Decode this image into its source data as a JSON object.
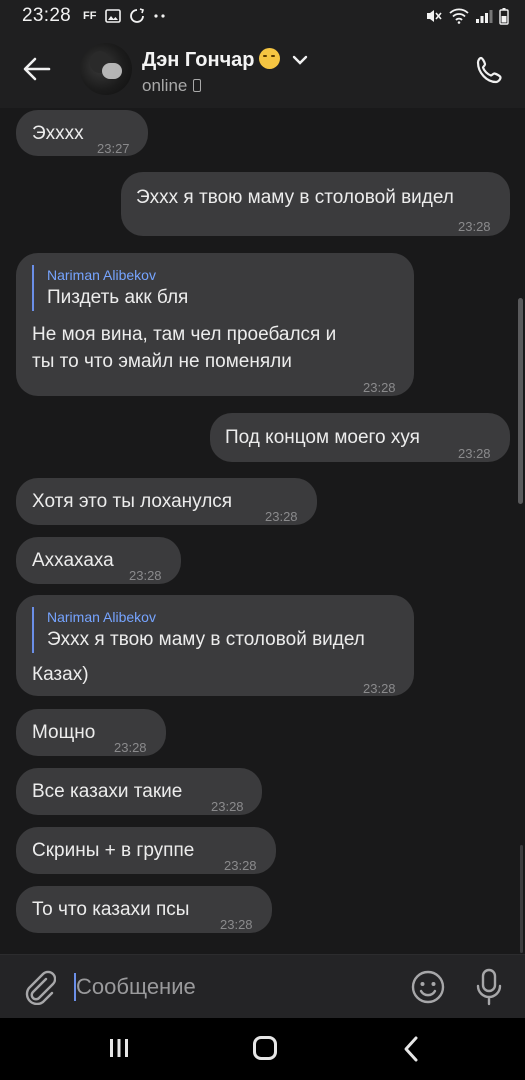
{
  "status_bar": {
    "time": "23:28",
    "ff_label": "FF",
    "icons_left": [
      "ff-icon",
      "image-icon",
      "sync-icon",
      "more-dots-icon"
    ],
    "icons_right": [
      "mute-icon",
      "wifi-icon",
      "signal-icon",
      "battery-icon"
    ]
  },
  "header": {
    "contact_name": "Дэн Гончар",
    "contact_status": "online",
    "name_emoji": "smiling-face-emoji"
  },
  "messages": [
    {
      "direction": "in",
      "text": "Эхххх",
      "time": "23:27"
    },
    {
      "direction": "out",
      "text": "Эхxx я твою маму в столовой видел",
      "time": "23:28"
    },
    {
      "direction": "in",
      "reply": {
        "author": "Nariman Alibekov",
        "text": "Пиздеть акк бля"
      },
      "text_lines": [
        "Не моя вина, там чел проебался и",
        "ты то что эмайл не поменяли"
      ],
      "time": "23:28"
    },
    {
      "direction": "out",
      "text": "Под концом моего хуя",
      "time": "23:28"
    },
    {
      "direction": "in",
      "text": "Хотя это ты лоханулся",
      "time": "23:28"
    },
    {
      "direction": "in",
      "text": "Аххахаха",
      "time": "23:28"
    },
    {
      "direction": "in",
      "reply": {
        "author": "Nariman Alibekov",
        "text": "Эхxx я твою маму в столовой видел"
      },
      "text": "Казах)",
      "time": "23:28"
    },
    {
      "direction": "in",
      "text": "Мощно",
      "time": "23:28"
    },
    {
      "direction": "in",
      "text": "Все казахи такие",
      "time": "23:28"
    },
    {
      "direction": "in",
      "text": "Скрины + в группе",
      "time": "23:28"
    },
    {
      "direction": "in",
      "text": "То что казахи псы",
      "time": "23:28"
    }
  ],
  "composer": {
    "placeholder": "Сообщение"
  },
  "colors": {
    "background": "#19191a",
    "bubble": "#3b3b3d",
    "accent": "#76a4ff"
  }
}
